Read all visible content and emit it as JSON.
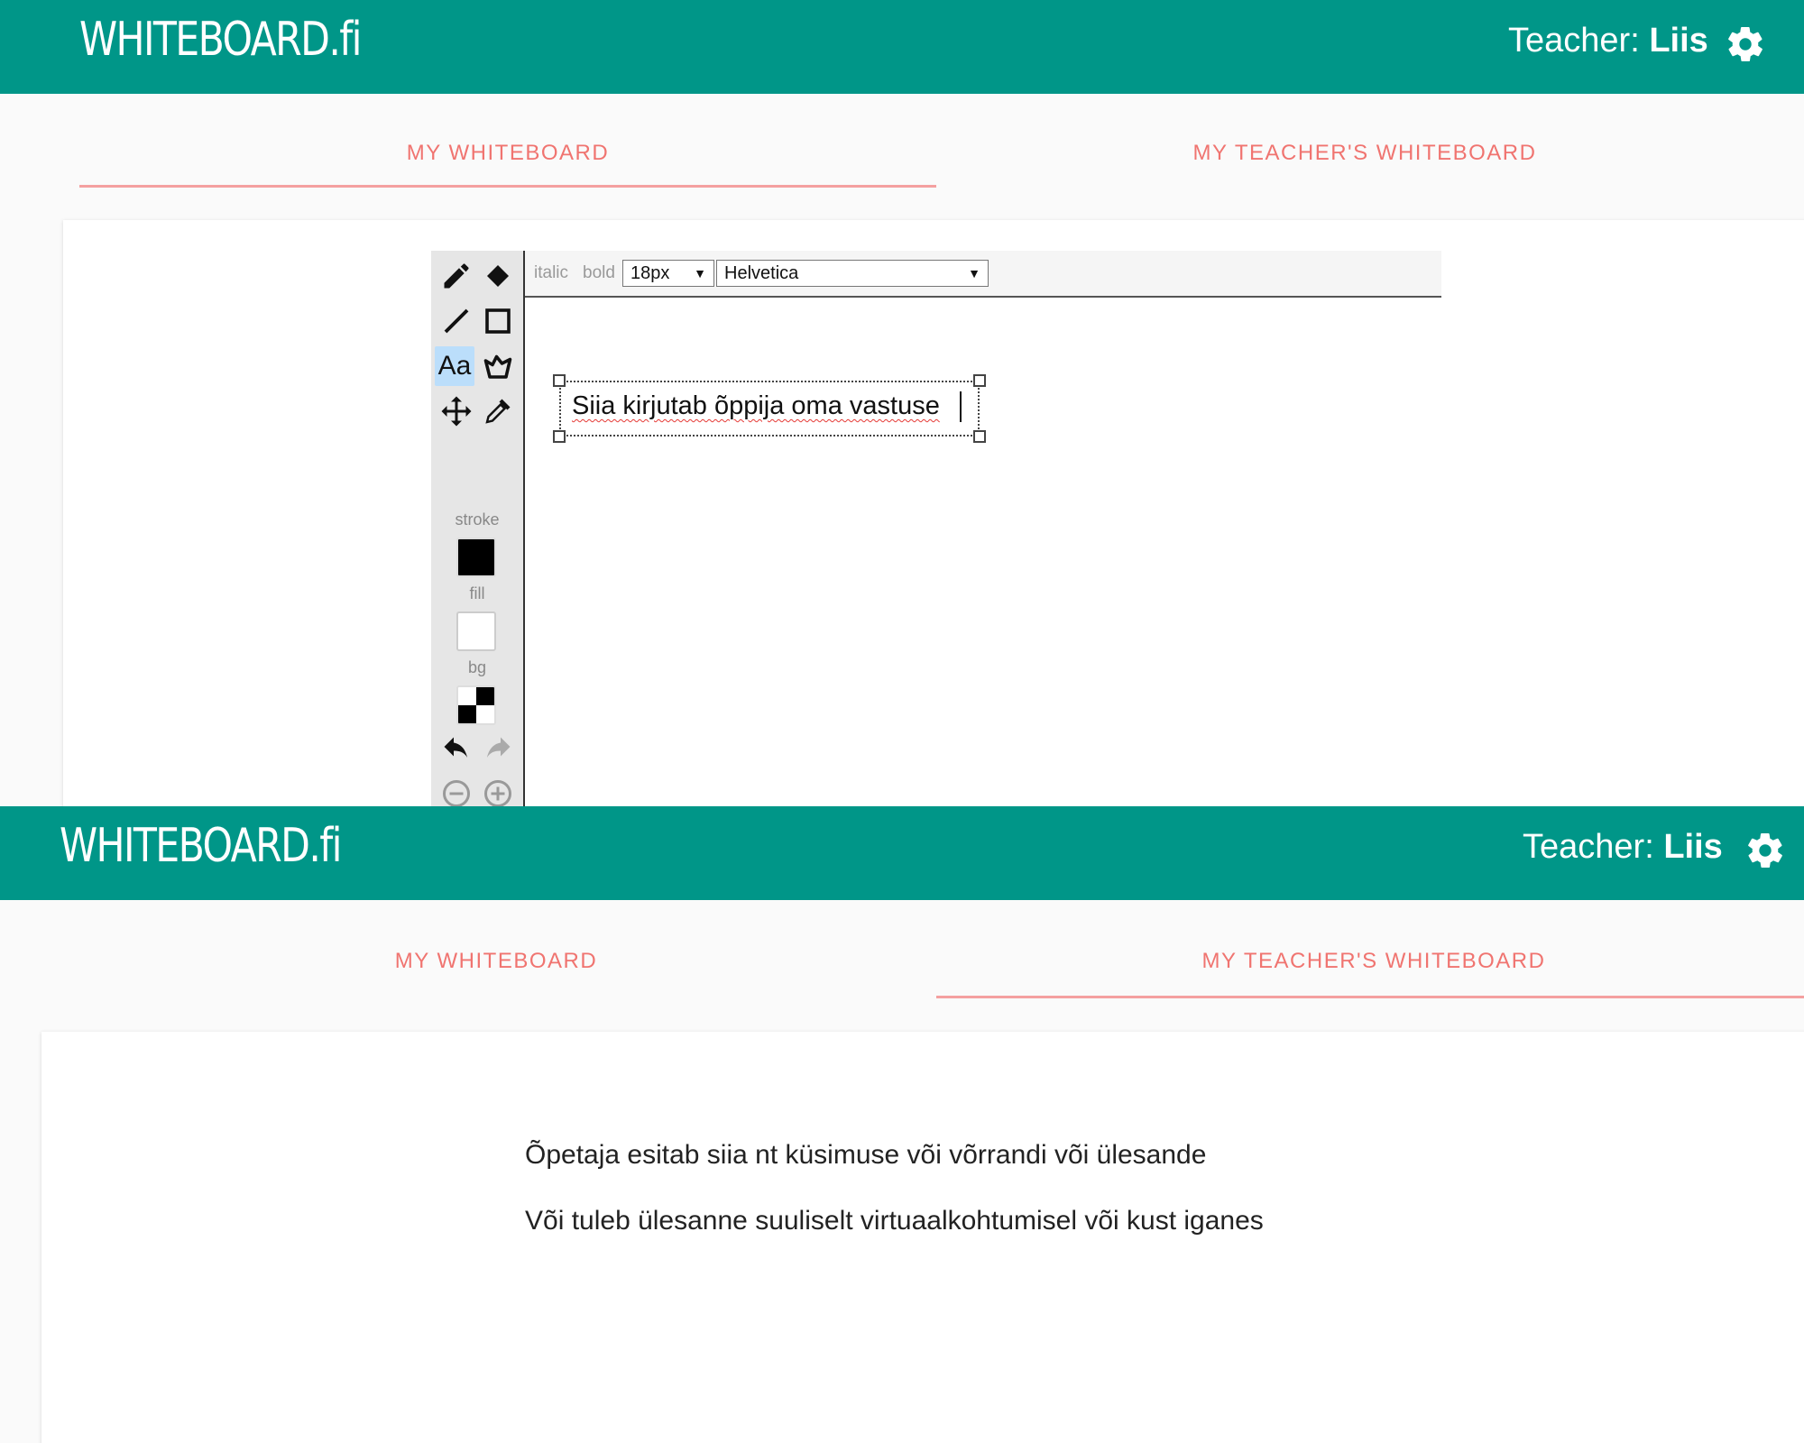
{
  "app": {
    "logo": "WHITEBOARD.fi",
    "teacher_prefix": "Teacher:",
    "teacher_name": "Liis"
  },
  "tabs": {
    "my_whiteboard": "MY WHITEBOARD",
    "teachers_whiteboard": "MY TEACHER'S WHITEBOARD"
  },
  "editor": {
    "options": {
      "italic": "italic",
      "bold": "bold",
      "font_size": "18px",
      "font_family": "Helvetica"
    },
    "labels": {
      "stroke": "stroke",
      "fill": "fill",
      "bg": "bg"
    },
    "text_box": "Siia kirjutab õppija oma vastuse",
    "active_tool": "text-tool"
  },
  "teacher_board": {
    "line1": "Õpetaja esitab siia nt küsimuse või võrrandi või ülesande",
    "line2": "Või tuleb ülesanne suuliselt virtuaalkohtumisel või kust iganes"
  },
  "colors": {
    "appbar": "#009688",
    "tab_text": "#f07470",
    "tab_indicator": "#f4a0a0",
    "active_tool": "#bbdefb"
  }
}
